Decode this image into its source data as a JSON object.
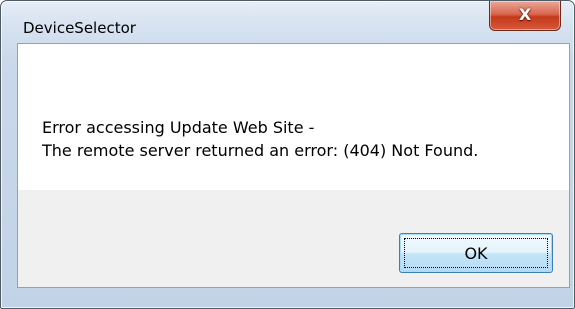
{
  "window": {
    "title": "DeviceSelector",
    "close_icon": "X"
  },
  "message": {
    "line1": "Error accessing Update Web Site -",
    "line2": "The remote server returned an error: (404) Not Found."
  },
  "buttons": {
    "ok_label": "OK"
  },
  "colors": {
    "frame": "#c9d8ea",
    "close_button": "#c4391c",
    "button_panel": "#f0f0f0",
    "ok_button_border": "#3c7fb1"
  }
}
